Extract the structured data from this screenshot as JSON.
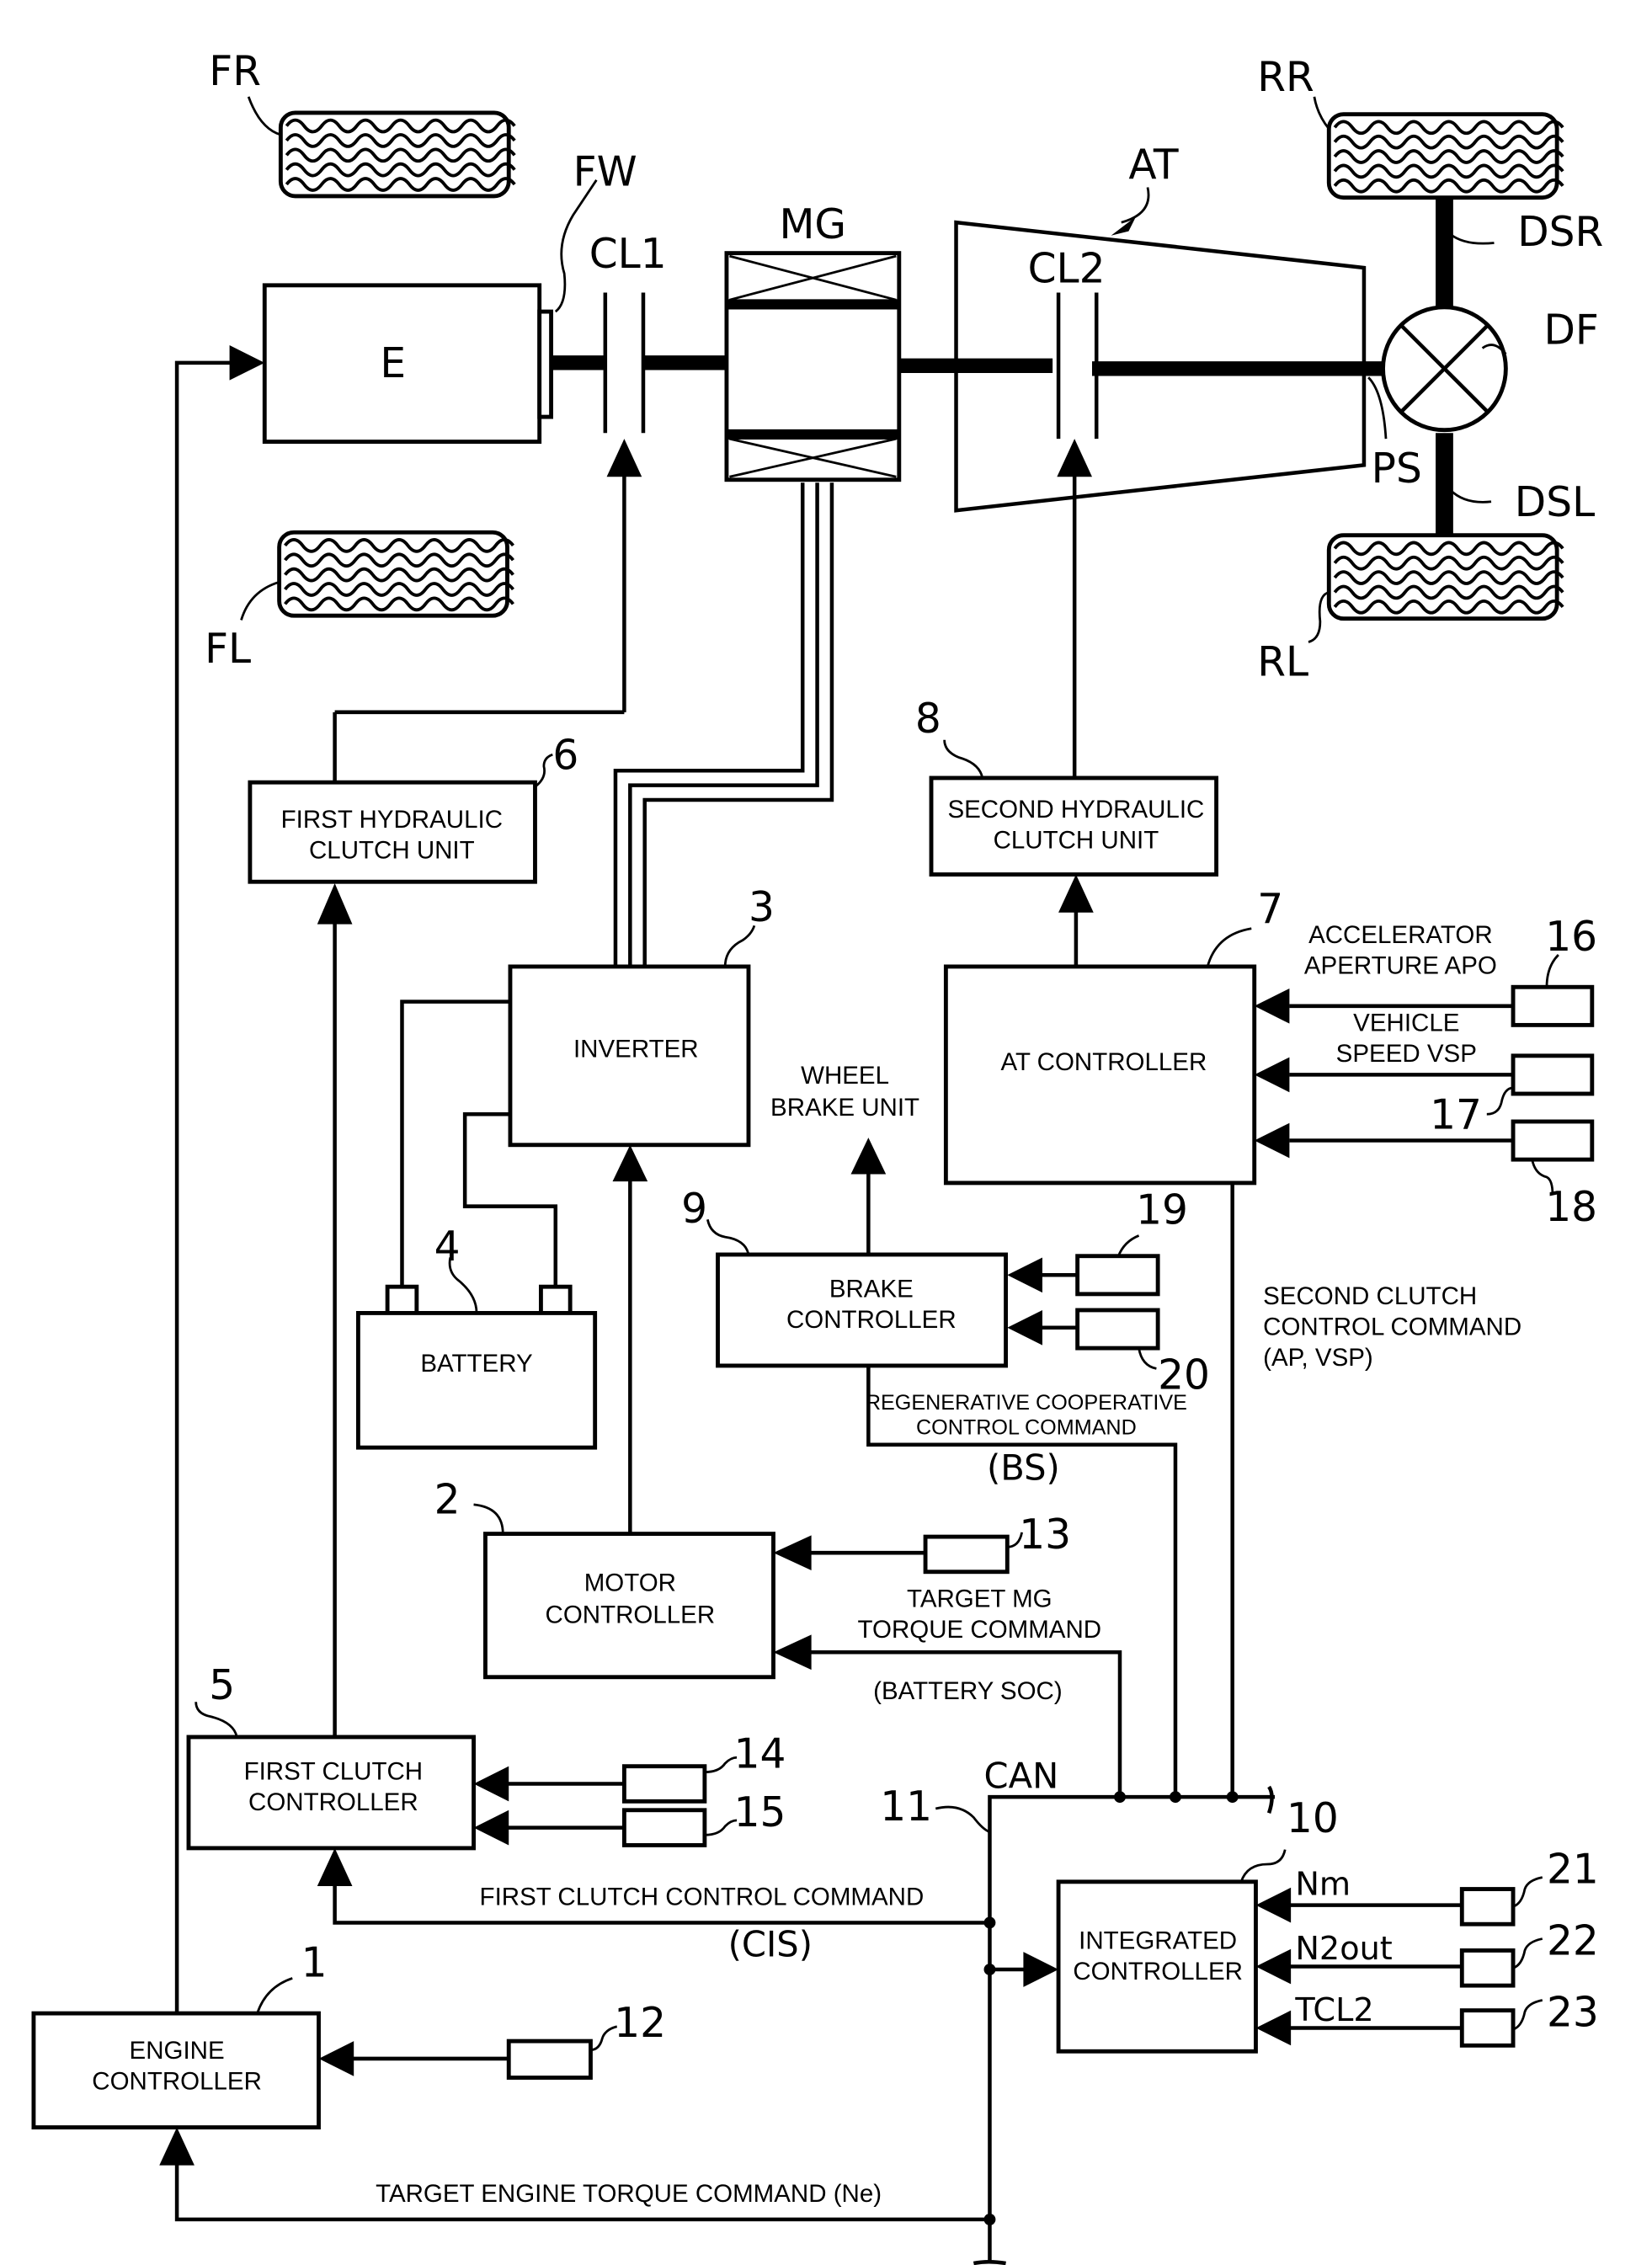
{
  "drivetrain": {
    "engine": "E",
    "flywheel": "FW",
    "first_clutch": "CL1",
    "motor_generator": "MG",
    "transmission": "AT",
    "second_clutch": "CL2",
    "propeller_shaft": "PS",
    "differential": "DF",
    "drive_shaft_right": "DSR",
    "drive_shaft_left": "DSL",
    "front_right_wheel": "FR",
    "front_left_wheel": "FL",
    "rear_right_wheel": "RR",
    "rear_left_wheel": "RL"
  },
  "blocks": {
    "engine_controller": {
      "ref": "1",
      "line1": "ENGINE",
      "line2": "CONTROLLER"
    },
    "motor_controller": {
      "ref": "2",
      "line1": "MOTOR",
      "line2": "CONTROLLER"
    },
    "inverter": {
      "ref": "3",
      "line1": "INVERTER"
    },
    "battery": {
      "ref": "4",
      "line1": "BATTERY"
    },
    "first_clutch_controller": {
      "ref": "5",
      "line1": "FIRST CLUTCH",
      "line2": "CONTROLLER"
    },
    "first_hydraulic_clutch_unit": {
      "ref": "6",
      "line1": "FIRST HYDRAULIC",
      "line2": "CLUTCH UNIT"
    },
    "at_controller": {
      "ref": "7",
      "line1": "AT CONTROLLER"
    },
    "second_hydraulic_clutch_unit": {
      "ref": "8",
      "line1": "SECOND HYDRAULIC",
      "line2": "CLUTCH UNIT"
    },
    "brake_controller": {
      "ref": "9",
      "line1": "BRAKE",
      "line2": "CONTROLLER"
    },
    "integrated_controller": {
      "ref": "10",
      "line1": "INTEGRATED",
      "line2": "CONTROLLER"
    },
    "wheel_brake_unit": {
      "line1": "WHEEL",
      "line2": "BRAKE UNIT"
    }
  },
  "sensors": {
    "s12": "12",
    "s13": "13",
    "s14": "14",
    "s15": "15",
    "s16": "16",
    "s17": "17",
    "s18": "18",
    "s19": "19",
    "s20": "20",
    "s21": "21",
    "s22": "22",
    "s23": "23"
  },
  "bus": {
    "ref": "11",
    "label": "CAN"
  },
  "signals": {
    "accelerator_1": "ACCELERATOR",
    "accelerator_2": "APERTURE APO",
    "vehicle_speed_1": "VEHICLE",
    "vehicle_speed_2": "SPEED VSP",
    "second_clutch_cmd_1": "SECOND CLUTCH",
    "second_clutch_cmd_2": "CONTROL COMMAND",
    "second_clutch_cmd_3": "(AP, VSP)",
    "regen_cmd_1": "REGENERATIVE COOPERATIVE",
    "regen_cmd_2": "CONTROL COMMAND",
    "regen_cmd_3": "(BS)",
    "target_mg_1": "TARGET MG",
    "target_mg_2": "TORQUE COMMAND",
    "battery_soc": "(BATTERY SOC)",
    "first_clutch_cmd": "FIRST CLUTCH CONTROL COMMAND",
    "first_clutch_cmd_2": "(CIS)",
    "target_engine_cmd": "TARGET ENGINE TORQUE COMMAND (Ne)",
    "nm": "Nm",
    "n2out": "N2out",
    "tcl2": "TCL2"
  }
}
